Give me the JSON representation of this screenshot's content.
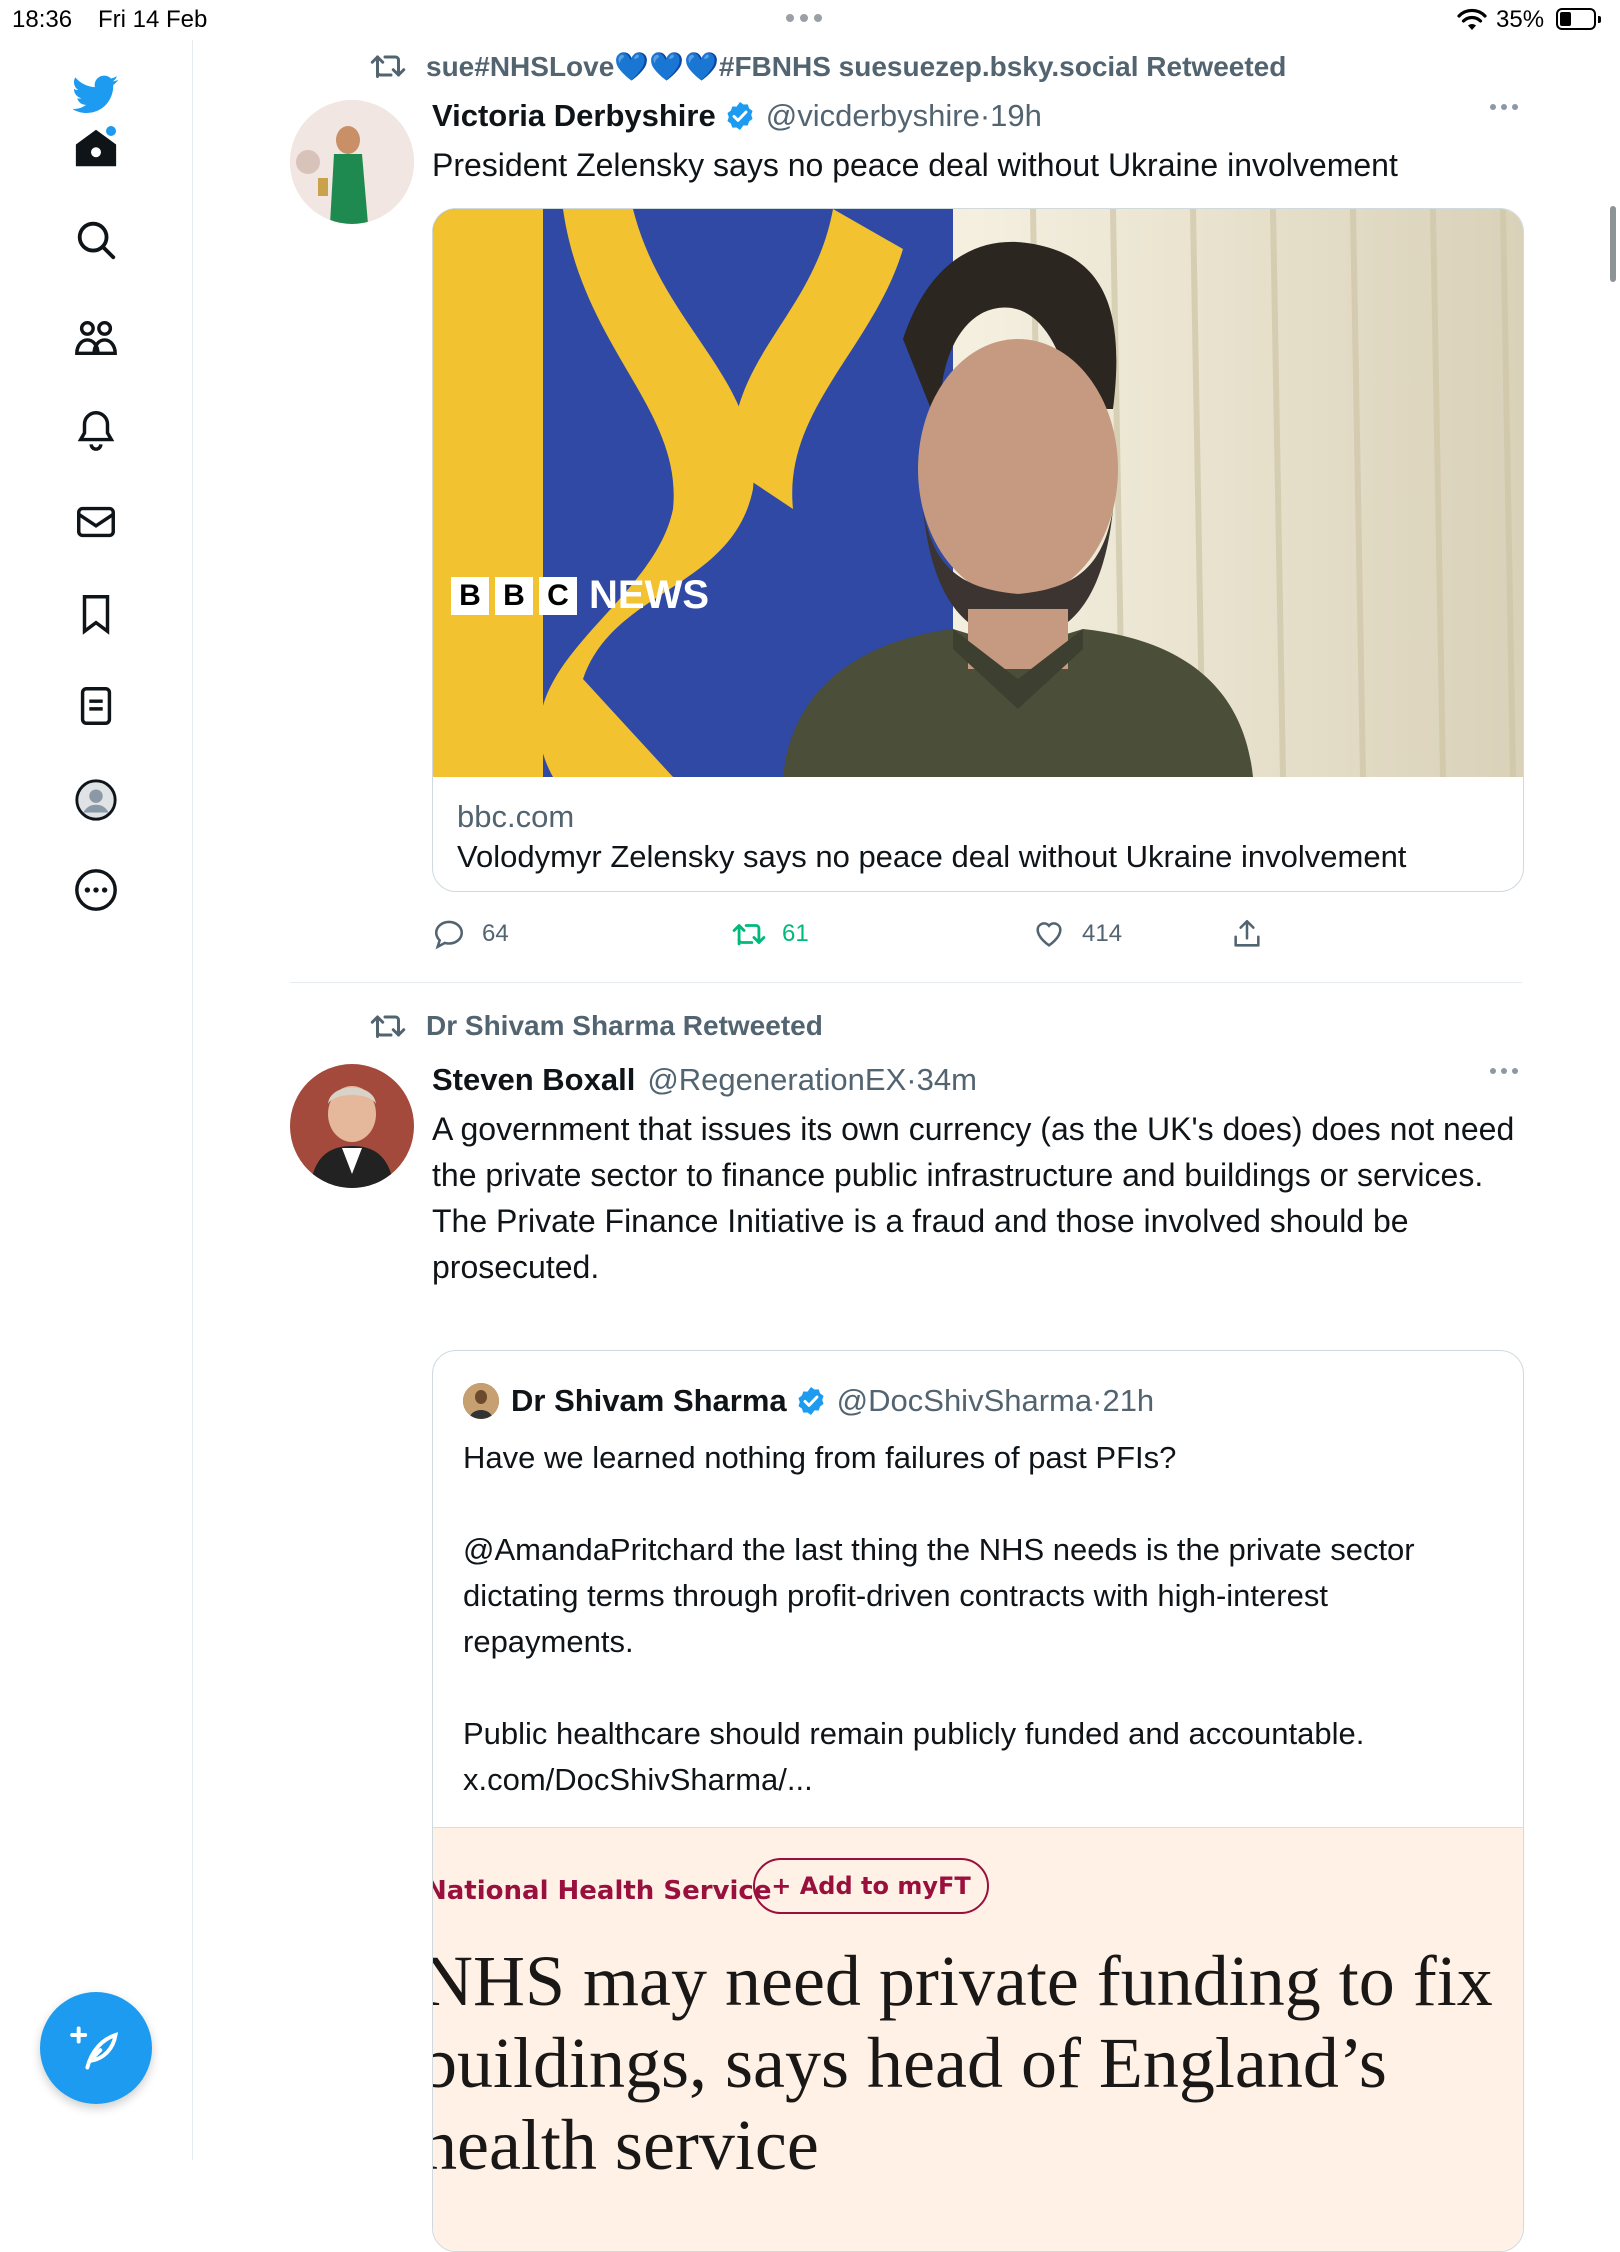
{
  "status_bar": {
    "time": "18:36",
    "date": "Fri 14 Feb",
    "battery": "35%",
    "battery_level": 0.35
  },
  "sidebar": {
    "items": [
      "twitter-logo",
      "home",
      "search",
      "communities",
      "notifications",
      "messages",
      "bookmarks",
      "lists",
      "profile",
      "more"
    ],
    "compose_label": "compose-tweet"
  },
  "tweets": [
    {
      "retweeted_by": "sue#NHSLove💙💙💙#FBNHS suesuezep.bsky.social Retweeted",
      "author_name": "Victoria Derbyshire",
      "verified": true,
      "handle": "@vicderbyshire",
      "time": "19h",
      "text": "President Zelensky says no peace deal without Ukraine involvement",
      "card": {
        "image_brand": "NEWS",
        "bbc_letters": [
          "B",
          "B",
          "C"
        ],
        "domain": "bbc.com",
        "title": "Volodymyr Zelensky says no peace deal without Ukraine involvement"
      },
      "stats": {
        "replies": "64",
        "retweets": "61",
        "likes": "414"
      }
    },
    {
      "retweeted_by": "Dr Shivam Sharma Retweeted",
      "author_name": "Steven Boxall",
      "verified": false,
      "handle": "@RegenerationEX",
      "time": "34m",
      "text": "A government that issues its own currency (as the UK's does) does not need the private sector to finance public infrastructure and buildings or services. The Private Finance Initiative is a fraud and those involved should be prosecuted.",
      "quote": {
        "author_name": "Dr Shivam Sharma",
        "verified": true,
        "handle": "@DocShivSharma",
        "time": "21h",
        "para1": "Have we learned nothing from failures of past PFIs?",
        "para2": "@AmandaPritchard the last thing the NHS needs is the private sector dictating terms through profit-driven contracts with high-interest repayments.",
        "para3": "Public healthcare should remain publicly funded and accountable.",
        "link": "x.com/DocShivSharma/...",
        "image": {
          "section": "National Health Service",
          "button": "+ Add to myFT",
          "headline": "NHS may need private funding to fix buildings, says head of England’s health service"
        }
      }
    }
  ],
  "colors": {
    "accent": "#1d9bf0",
    "retweet_green": "#00ba7c",
    "ft_claret": "#990f3d",
    "ft_paper": "#fff1e5"
  }
}
